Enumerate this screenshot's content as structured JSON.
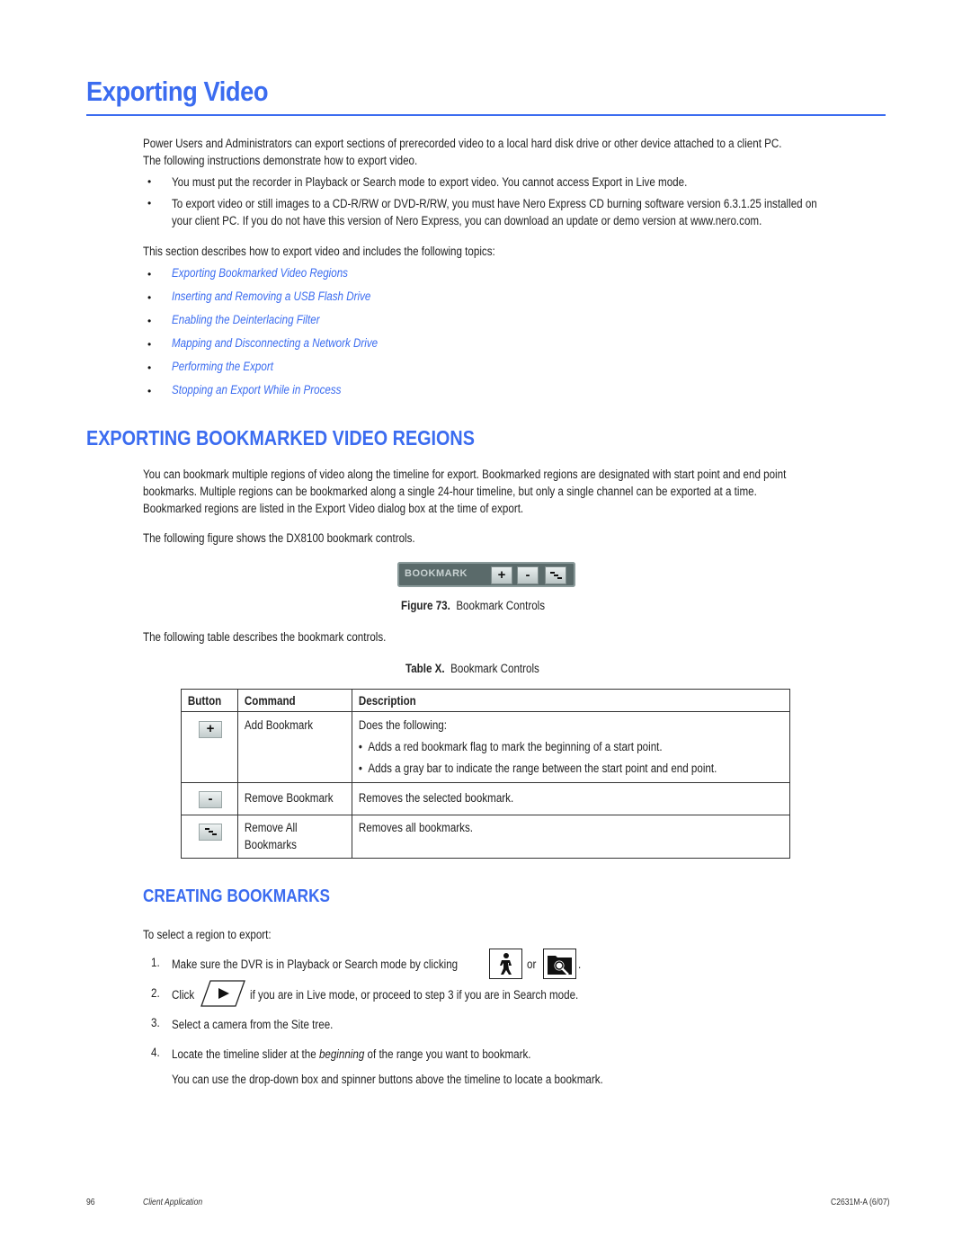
{
  "page": {
    "title": "Exporting Video",
    "intro": [
      "Power Users and Administrators can export sections of prerecorded video to a local hard disk drive or other device attached to a client PC.",
      "The following instructions demonstrate how to export video."
    ],
    "notes": [
      "You must put the recorder in Playback or Search mode to export video. You cannot access Export in Live mode.",
      "To export video or still images to a CD-R/RW or DVD-R/RW, you must have Nero Express CD burning software version 6.3.1.25 installed on",
      "your client PC. If you do not have this version of Nero Express, you can download an update or demo version at www.nero.com."
    ],
    "topics_intro": "This section describes how to export video and includes the following topics:",
    "topics": [
      "Exporting Bookmarked Video Regions",
      "Inserting and Removing a USB Flash Drive",
      "Enabling the Deinterlacing Filter",
      "Mapping and Disconnecting a Network Drive",
      "Performing the Export",
      "Stopping an Export While in Process"
    ],
    "bullet": "•"
  },
  "section1": {
    "heading": "EXPORTING BOOKMARKED VIDEO REGIONS",
    "paragraph": [
      "You can bookmark multiple regions of video along the timeline for export. Bookmarked regions are designated with start point and end point",
      "bookmarks. Multiple regions can be bookmarked along a single 24-hour timeline, but only a single channel can be exported at a time.",
      "Bookmarked regions are listed in the Export Video dialog box at the time of export."
    ],
    "figure_intro": "The following figure shows the DX8100 bookmark controls.",
    "figure": {
      "label": "BOOKMARK",
      "buttons": [
        "+",
        "-",
        "remove-all"
      ],
      "caption_num": "Figure 73.",
      "caption_text": "Bookmark Controls"
    },
    "table_intro": "The following table describes the bookmark controls.",
    "table": {
      "caption_num": "Table X.",
      "caption_text": "Bookmark Controls",
      "headers": [
        "Button",
        "Command",
        "Description"
      ],
      "rows": [
        {
          "icon": "+",
          "command": "Add Bookmark",
          "description": "Does the following:",
          "bullets": [
            "Adds a red bookmark flag to mark the beginning of a start point.",
            "Adds a gray bar to indicate the range between the start point and end point."
          ]
        },
        {
          "icon": "-",
          "command": "Remove Bookmark",
          "description": "Removes the selected bookmark."
        },
        {
          "icon": "remove-all",
          "command_line1": "Remove All",
          "command_line2": "Bookmarks",
          "description": "Removes all bookmarks."
        }
      ]
    }
  },
  "section2": {
    "heading": "CREATING BOOKMARKS",
    "intro": "To select a region to export:",
    "steps": [
      {
        "num": "1.",
        "text": "Make sure the DVR is in Playback or Search mode by clicking",
        "or": "or",
        "end": "."
      },
      {
        "num": "2.",
        "pre": "Click",
        "text": "if you are in Live mode, or proceed to step 3 if you are in Search mode."
      },
      {
        "num": "3.",
        "text": "Select a camera from the Site tree."
      },
      {
        "num": "4.",
        "pre": "Locate the timeline slider at the",
        "em": "beginning",
        "post": "of the range you want to bookmark.",
        "sub": "You can use the drop-down box and spinner buttons above the timeline to locate a bookmark."
      }
    ]
  },
  "footer": {
    "page_number": "96",
    "section": "Client Application",
    "doc_id": "C2631M-A (6/07)"
  },
  "colors": {
    "accent": "#3b6cf0",
    "text": "#222222"
  }
}
